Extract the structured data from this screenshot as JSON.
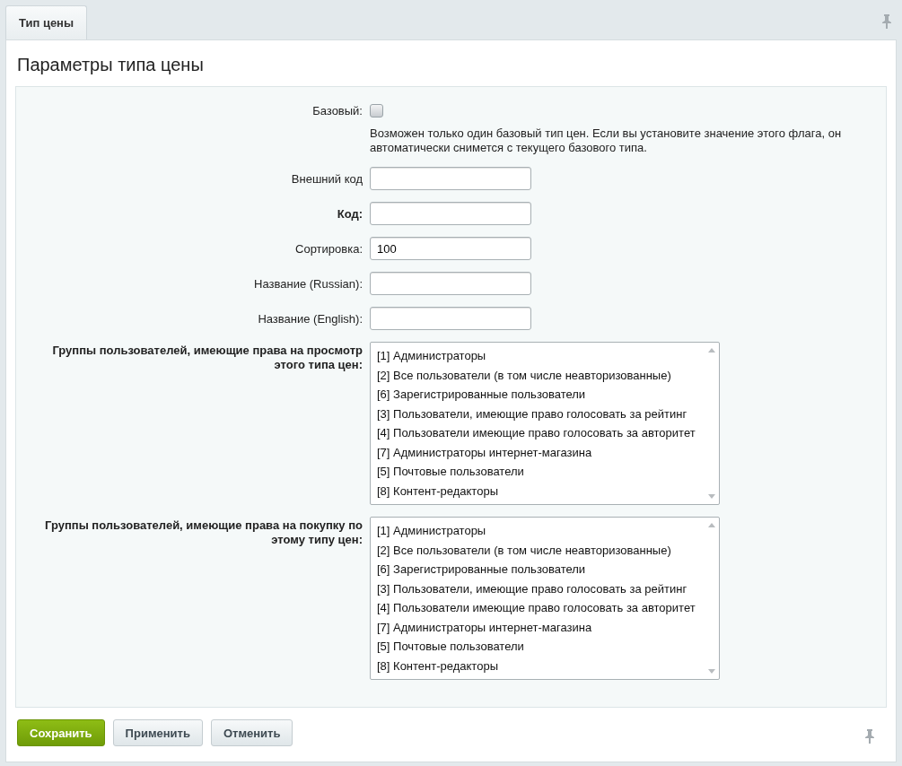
{
  "tabs": [
    {
      "label": "Тип цены",
      "selected": true
    }
  ],
  "form": {
    "title": "Параметры типа цены",
    "fields": [
      {
        "kind": "checkbox",
        "label": "Базовый:",
        "required": false,
        "checked": false,
        "note": "Возможен только один базовый тип цен. Если вы установите значение этого флага, он автоматически снимется с текущего базового типа."
      },
      {
        "kind": "text",
        "label": "Внешний код",
        "required": false
      },
      {
        "kind": "text",
        "label": "Код:",
        "required": true
      },
      {
        "kind": "text",
        "label": "Сортировка:",
        "required": false,
        "value": "100"
      },
      {
        "kind": "text",
        "label": "Название (Russian):",
        "required": false
      },
      {
        "kind": "text",
        "label": "Название (English):",
        "required": false
      },
      {
        "kind": "listbox",
        "label": "Группы пользователей, имеющие права на просмотр этого типа цен:",
        "required": true,
        "options": [
          {
            "label": "[1] Администраторы",
            "selected": false
          },
          {
            "label": "[2] Все пользователи (в том числе неавторизованные)",
            "selected": false
          },
          {
            "label": "[6] Зарегистрированные пользователи",
            "selected": false
          },
          {
            "label": "[3] Пользователи, имеющие право голосовать за рейтинг",
            "selected": false
          },
          {
            "label": "[4] Пользователи имеющие право голосовать за авторитет",
            "selected": false
          },
          {
            "label": "[7] Администраторы интернет-магазина",
            "selected": false
          },
          {
            "label": "[5] Почтовые пользователи",
            "selected": false
          },
          {
            "label": "[8] Контент-редакторы",
            "selected": false
          }
        ]
      },
      {
        "kind": "listbox",
        "label": "Группы пользователей, имеющие права на покупку по этому типу цен:",
        "required": true,
        "options": [
          {
            "label": "[1] Администраторы",
            "selected": false
          },
          {
            "label": "[2] Все пользователи (в том числе неавторизованные)",
            "selected": false
          },
          {
            "label": "[6] Зарегистрированные пользователи",
            "selected": false
          },
          {
            "label": "[3] Пользователи, имеющие право голосовать за рейтинг",
            "selected": false
          },
          {
            "label": "[4] Пользователи имеющие право голосовать за авторитет",
            "selected": false
          },
          {
            "label": "[7] Администраторы интернет-магазина",
            "selected": false
          },
          {
            "label": "[5] Почтовые пользователи",
            "selected": false
          },
          {
            "label": "[8] Контент-редакторы",
            "selected": false
          }
        ]
      }
    ]
  },
  "buttons": [
    {
      "kind": "primary",
      "label": "Сохранить"
    },
    {
      "kind": "secondary",
      "label": "Применить"
    },
    {
      "kind": "secondary",
      "label": "Отменить"
    }
  ]
}
